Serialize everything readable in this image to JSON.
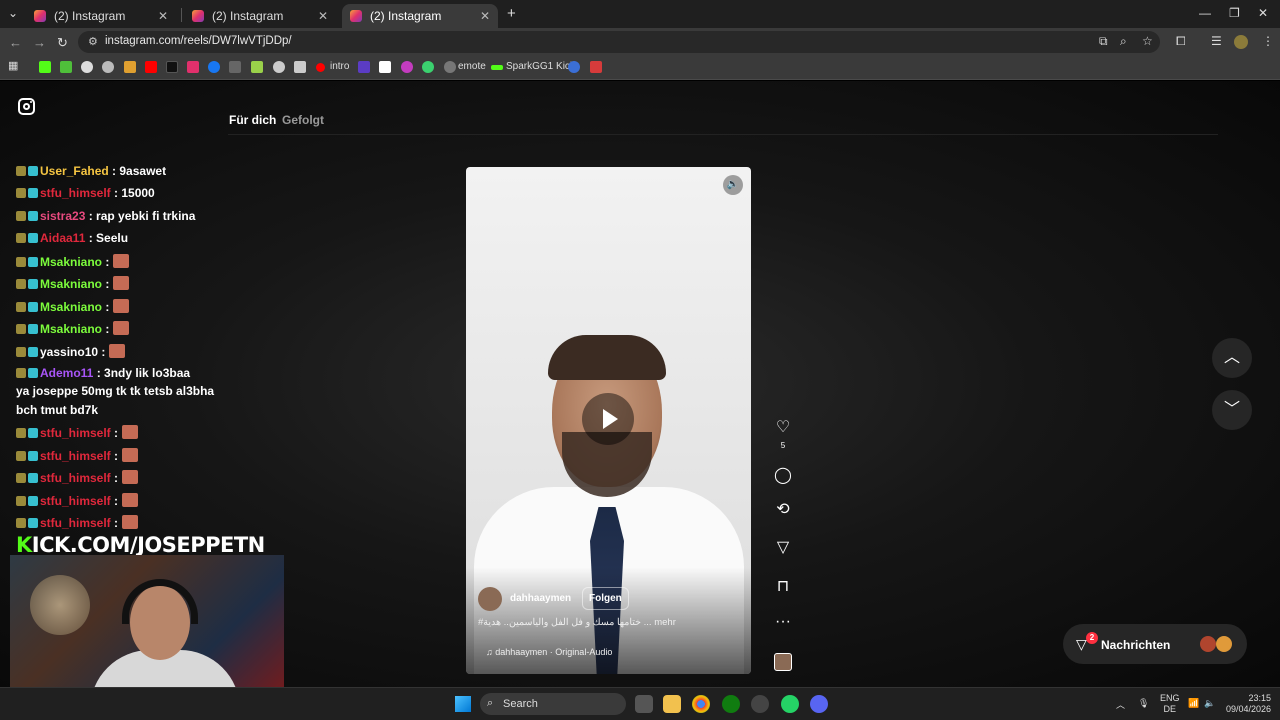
{
  "browser": {
    "tabs": [
      {
        "title": "(2) Instagram",
        "active": false
      },
      {
        "title": "(2) Instagram",
        "active": false
      },
      {
        "title": "(2) Instagram",
        "active": true
      }
    ],
    "new_tab": "+",
    "url": "instagram.com/reels/DW7lwVTjDDp/",
    "bookmarks": {
      "intro": "intro",
      "emote": "emote",
      "sparkgg1": "SparkGG1 Kick"
    }
  },
  "instagram": {
    "feed_tabs": [
      "Für dich",
      "Gefolgt"
    ],
    "reel": {
      "username": "dahhaaymen",
      "follow_label": "Folgen",
      "caption": "#ختامها مسك و فل الفل والياسمين.. هدية ... mehr",
      "audio": "dahhaaymen · Original-Audio",
      "like_count": "5"
    },
    "messages_label": "Nachrichten",
    "messages_badge": "2"
  },
  "chat": {
    "messages": [
      {
        "user": "User_Fahed",
        "text": " : 9asawet",
        "color": "#f5c542"
      },
      {
        "user": "stfu_himself",
        "text": " : 15000",
        "color": "#e0283c"
      },
      {
        "user": "sistra23",
        "text": " : rap yebki fi trkina",
        "color": "#e84a7f"
      },
      {
        "user": "Aidaa11",
        "text": " : Seelu",
        "color": "#e0283c"
      },
      {
        "user": "Msakniano",
        "text": " :",
        "color": "#7cfc3c"
      },
      {
        "user": "Msakniano",
        "text": " :",
        "color": "#7cfc3c"
      },
      {
        "user": "Msakniano",
        "text": " :",
        "color": "#7cfc3c"
      },
      {
        "user": "Msakniano",
        "text": " :",
        "color": "#7cfc3c"
      },
      {
        "user": "yassino10",
        "text": " :",
        "color": "#ffffff"
      },
      {
        "user": "Ademo11",
        "text": " : 3ndy lik lo3baa",
        "color": "#a855f7"
      },
      {
        "user": "",
        "text": "ya joseppe 50mg tk tk tetsb al3bha",
        "color": "#ffffff"
      },
      {
        "user": "",
        "text": "bch tmut bd7k",
        "color": "#ffffff"
      },
      {
        "user": "stfu_himself",
        "text": " :",
        "color": "#e0283c"
      },
      {
        "user": "stfu_himself",
        "text": " :",
        "color": "#e0283c"
      },
      {
        "user": "stfu_himself",
        "text": " :",
        "color": "#e0283c"
      },
      {
        "user": "stfu_himself",
        "text": " :",
        "color": "#e0283c"
      },
      {
        "user": "stfu_himself",
        "text": " :",
        "color": "#e0283c"
      }
    ],
    "banner_k": "K",
    "banner_rest": "ICK.COM/JOSEPPETN"
  },
  "taskbar": {
    "search_label": "Search",
    "lang_top": "ENG",
    "lang_bottom": "DE",
    "time": "23:15",
    "date": "09/04/2026"
  },
  "colors": {
    "kick_green": "#53fc18",
    "instagram_badge": "#ff3040"
  }
}
